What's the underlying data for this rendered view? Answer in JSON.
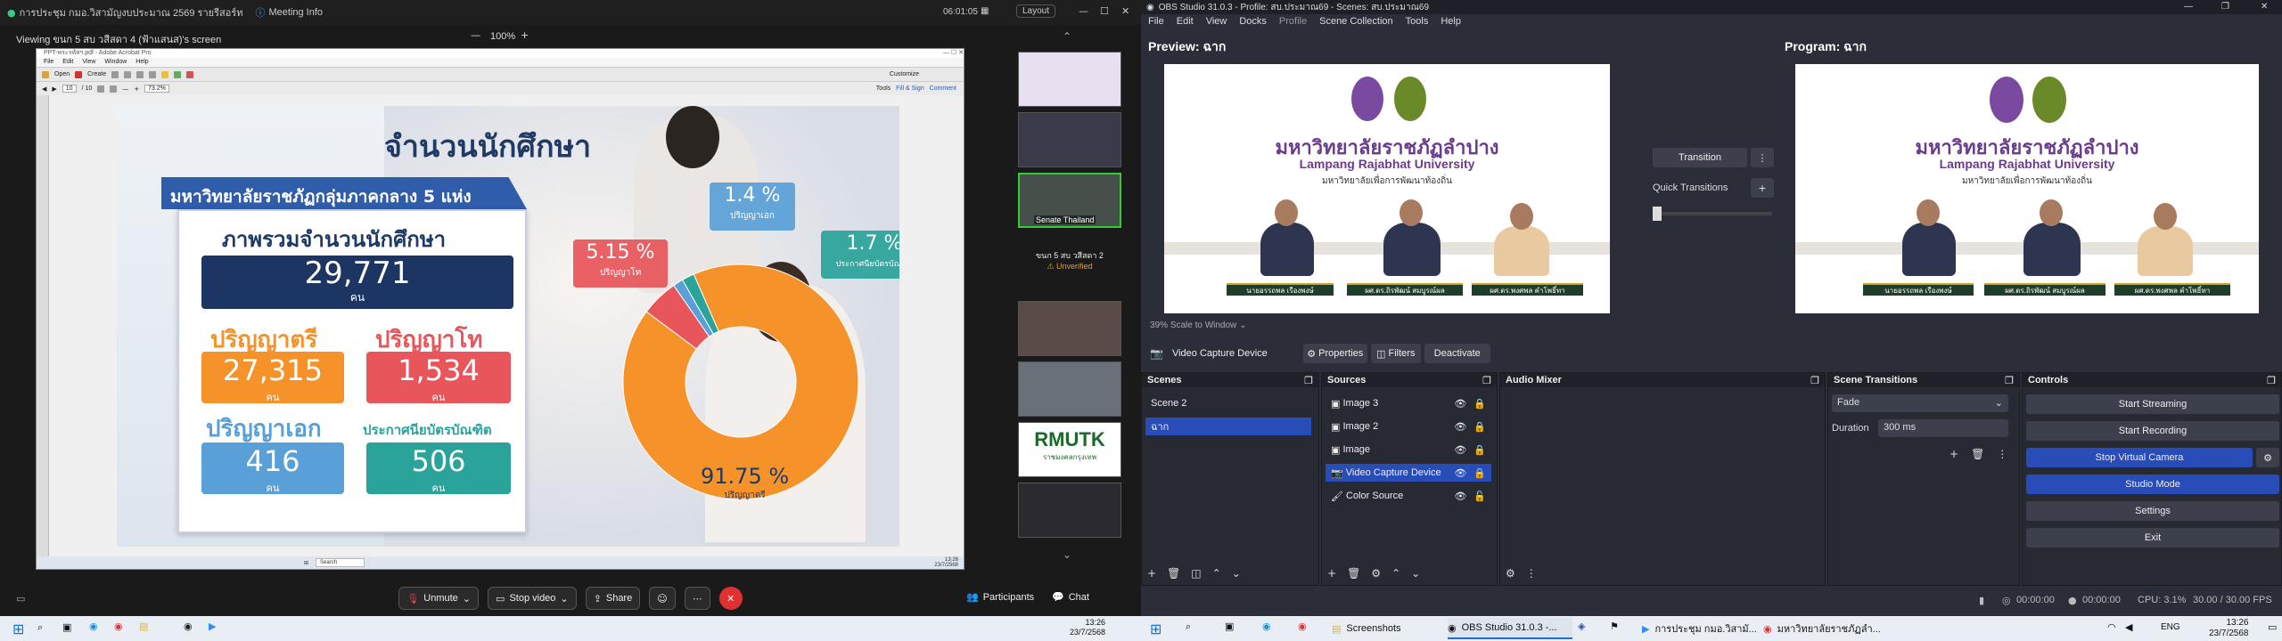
{
  "zoom": {
    "title": "การประชุม กมอ.วิสามัญงบประมาณ 2569 รายรีสอร์ท",
    "meeting_info": "Meeting Info",
    "timer": "06:01:05",
    "layout": "Layout",
    "viewing": "Viewing ขนก 5 สบ วสีสดา 4 (ฟ้าแสนส)'s screen",
    "zoom_pct": "100%",
    "gallery_label_1": "Senate Thailand",
    "gallery_name": "ขนก 5 สบ วสีสดา 2",
    "gallery_status": "Unverified",
    "gallery_logo": "RMUTK",
    "gallery_logo_sub": "ราชมงคลกรุงเทพ",
    "controls": {
      "unmute": "Unmute",
      "stop_video": "Stop video",
      "share": "Share",
      "participants": "Participants",
      "chat": "Chat"
    }
  },
  "pdf": {
    "title": "PPT-พระรหัสฯ.pdf - Adobe Acrobat Pro",
    "menu": [
      "File",
      "Edit",
      "View",
      "Window",
      "Help"
    ],
    "open": "Open",
    "create": "Create",
    "customize": "Customize",
    "page": "10",
    "pages": "/ 10",
    "zoom": "73.2%",
    "tools": "Tools",
    "fill_sign": "Fill & Sign",
    "comment": "Comment"
  },
  "slide": {
    "title": "จำนวนนักศึกษา",
    "banner": "มหาวิทยาลัยราชภัฏกลุ่มภาคกลาง 5 แห่ง",
    "overall_label": "ภาพรวมจำนวนนักศึกษา",
    "overall_value": "29,771",
    "unit": "คน",
    "bachelor_label": "ปริญญาตรี",
    "bachelor_value": "27,315",
    "master_label": "ปริญญาโท",
    "master_value": "1,534",
    "doctor_label": "ปริญญาเอก",
    "doctor_value": "416",
    "grad_cert_label": "ประกาศนียบัตรบัณฑิต",
    "grad_cert_value": "506",
    "pie_labels": [
      {
        "pct": "91.75 %",
        "name": "ปริญญาตรี"
      },
      {
        "pct": "5.15 %",
        "name": "ปริญญาโท"
      },
      {
        "pct": "1.4 %",
        "name": "ปริญญาเอก"
      },
      {
        "pct": "1.7 %",
        "name": "ประกาศนียบัตรบัณฑิต"
      }
    ]
  },
  "chart_data": {
    "type": "pie",
    "categories": [
      "ปริญญาตรี",
      "ปริญญาโท",
      "ปริญญาเอก",
      "ประกาศนียบัตรบัณฑิต"
    ],
    "values": [
      91.75,
      5.15,
      1.4,
      1.7
    ],
    "colors": [
      "#f5922a",
      "#e8555a",
      "#5aa0d8",
      "#2aa39a"
    ]
  },
  "obs": {
    "title": "OBS Studio 31.0.3 - Profile: สบ.ประมาณ69 - Scenes: สบ.ประมาณ69",
    "menu": [
      "File",
      "Edit",
      "View",
      "Docks",
      "Profile",
      "Scene Collection",
      "Tools",
      "Help"
    ],
    "preview": "Preview: ฉาก",
    "program": "Program: ฉาก",
    "transition": "Transition",
    "quick_transitions": "Quick Transitions",
    "scale": "39%  Scale to Window",
    "source_name": "Video Capture Device",
    "properties": "Properties",
    "filters": "Filters",
    "deactivate": "Deactivate",
    "scenes_hdr": "Scenes",
    "sources_hdr": "Sources",
    "mixer_hdr": "Audio Mixer",
    "trans_hdr": "Scene Transitions",
    "controls_hdr": "Controls",
    "scenes": [
      "Scene 2",
      "ฉาก"
    ],
    "sources": [
      "Image 3",
      "Image 2",
      "Image",
      "Video Capture Device",
      "Color Source"
    ],
    "fade": "Fade",
    "duration_label": "Duration",
    "duration": "300 ms",
    "controls": [
      "Start Streaming",
      "Start Recording",
      "Stop Virtual Camera",
      "Studio Mode",
      "Settings",
      "Exit"
    ],
    "status": {
      "rec1": "00:00:00",
      "rec2": "00:00:00",
      "cpu": "CPU: 3.1%",
      "fps": "30.00 / 30.00 FPS"
    },
    "video_th": "มหาวิทยาลัยราชภัฏลำปาง",
    "video_en": "Lampang Rajabhat University",
    "video_sub": "มหาวิทยาลัยเพื่อการพัฒนาท้องถิ่น",
    "names": [
      "นายอรรถพล เรืองพงษ์",
      "ผศ.ดร.ถิรพัฒน์ สมบูรณ์ผล",
      "ผศ.ดร.พงศพล คำโพธิ์ทา"
    ]
  },
  "taskbar": {
    "left_time": "13:26",
    "left_date": "23/7/2568",
    "items": [
      "Screenshots",
      "OBS Studio 31.0.3 -...",
      "การประชุม กมอ.วิสามั...",
      "มหาวิทยาลัยราชภัฏลำ..."
    ],
    "lang": "ENG",
    "time": "13:26",
    "date": "23/7/2568"
  },
  "pdf_taskbar": {
    "search": "Search",
    "time": "13:26",
    "date": "23/7/2568"
  }
}
